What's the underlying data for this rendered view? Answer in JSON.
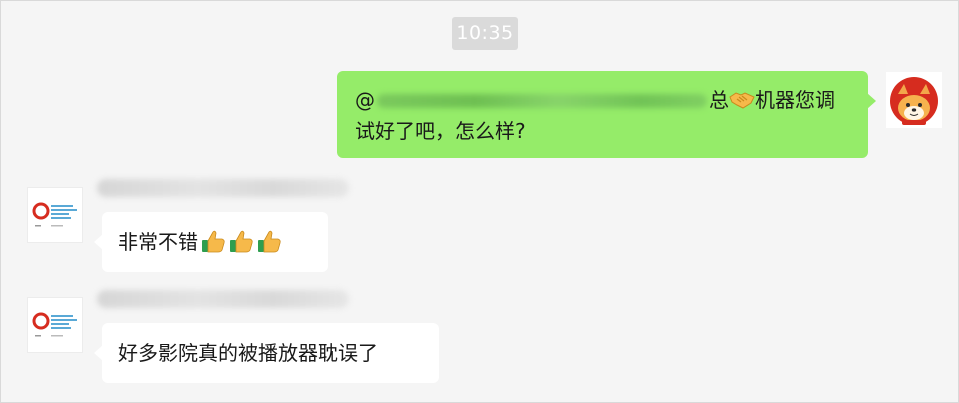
{
  "chat": {
    "timestamp": "10:35",
    "outgoing": {
      "prefix": "@",
      "suffix": "总",
      "emoji": "handshake-emoji",
      "text_after_emoji": "机器您调",
      "line2": "试好了吧，怎么样?"
    },
    "incoming": [
      {
        "text": "非常不错",
        "emojis": [
          "thumbs-up-emoji",
          "thumbs-up-emoji",
          "thumbs-up-emoji"
        ]
      },
      {
        "text": "好多影院真的被播放器耽误了"
      }
    ]
  },
  "colors": {
    "background": "#f5f5f5",
    "outgoing_bubble": "#95ec69",
    "incoming_bubble": "#ffffff",
    "timestamp_bg": "#dadada",
    "brand_red": "#d62c1f"
  }
}
